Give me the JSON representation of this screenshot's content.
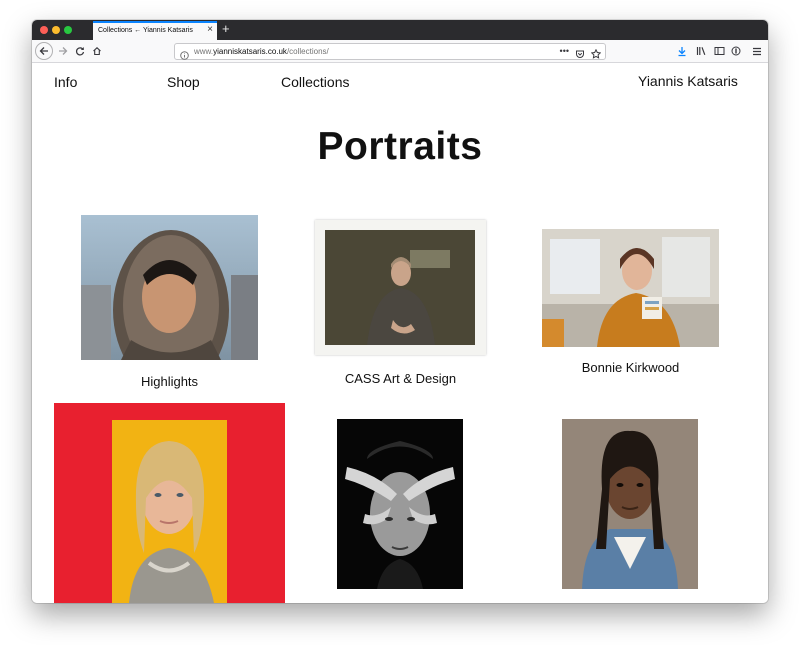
{
  "browser": {
    "tab_title": "Collections ← Yiannis Katsaris",
    "url_domain": "yianniskatsaris.co.uk",
    "url_prefix": "www.",
    "url_path": "/collections/"
  },
  "site": {
    "nav": [
      "Info",
      "Shop",
      "Collections"
    ],
    "brand": "Yiannis Katsaris"
  },
  "page": {
    "title": "Portraits"
  },
  "collections": [
    {
      "caption": "Highlights"
    },
    {
      "caption": "CASS Art & Design"
    },
    {
      "caption": "Bonnie Kirkwood"
    }
  ],
  "colors": {
    "accent_tab": "#0a84ff",
    "red_panel": "#e8202f",
    "yellow_backdrop": "#f2b313"
  }
}
